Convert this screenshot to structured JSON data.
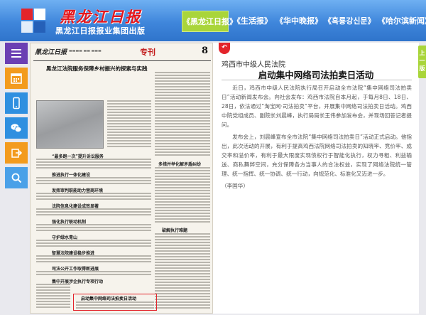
{
  "header": {
    "logo_title": "黑龙江日报",
    "logo_subtitle": "黑龙江日报报业集团出版",
    "brand_color": "#3f86db"
  },
  "nav": {
    "items": [
      {
        "label": "《黑龙江日报》",
        "active": true
      },
      {
        "label": "《生活报》",
        "active": false
      },
      {
        "label": "《华中晚报》",
        "active": false
      },
      {
        "label": "《흑룡강신문》",
        "active": false
      },
      {
        "label": "《哈尔滨新闻》",
        "active": false
      }
    ],
    "active_color": "#a9d53a"
  },
  "toolbar": {
    "items": [
      {
        "icon": "menu-icon",
        "color": "#6b3fb3"
      },
      {
        "icon": "calendar-icon",
        "color": "#f39b1e"
      },
      {
        "icon": "mobile-icon",
        "color": "#2f8fe0"
      },
      {
        "icon": "wechat-icon",
        "color": "#2f8fe0"
      },
      {
        "icon": "share-icon",
        "color": "#f39b1e"
      },
      {
        "icon": "search-icon",
        "color": "#4aa0e8"
      }
    ]
  },
  "newspaper": {
    "masthead": "黑龙江日报",
    "column": "专刊",
    "page_number": "8",
    "headline": "黑龙江法院服务保障乡村振兴的探索与实践",
    "subheads": [
      "“最多跑一次”提升诉讼服务",
      "推进执行一体化建设",
      "发挥审判职能助力营商环境",
      "法院信息化建设成效显著",
      "强化执行联动机制",
      "守护绿水青山",
      "智慧法院建设稳步推进",
      "司法公开工作取得新进展",
      "集中开展涉企执行专项行动",
      "多措并举化解矛盾纠纷",
      "破解执行难题"
    ],
    "highlight_title": "启动集中网络司法拍卖日活动"
  },
  "article": {
    "source": "鸡西市中级人民法院",
    "title": "启动集中网络司法拍卖日活动",
    "paragraphs": [
      "近日，鸡西市中级人民法院执行局召开启动全市法院“集中网络司法拍卖日”活动新闻发布会。向社会发布：鸡西市法院自本月起，于每月8日、18日、28日，依法通过“淘宝网·司法拍卖”平台，开展集中网络司法拍卖日活动。鸡西中院党组成员、副院长刘晨峰，执行局局长王伟参加发布会，并现场回答记者提问。",
      "发布会上，刘晨峰宣布全市法院“集中网络司法拍卖日”活动正式启动。他指出，此次活动的开展，有利于提高鸡西法院网络司法拍卖的知晓率、竞价率、成交率和溢价率，有利于最大限度实现债权行于智能化执行，权力寻租、利益输送、商私舞弊空间，充分保障各方当事人的合法权益，实现了网络法院统一管理、统一指挥、统一协调、统一行动，向规范化、标准化又迈进一步。"
    ],
    "author": "（李国华）"
  },
  "page_tab": {
    "label": "上一版"
  }
}
